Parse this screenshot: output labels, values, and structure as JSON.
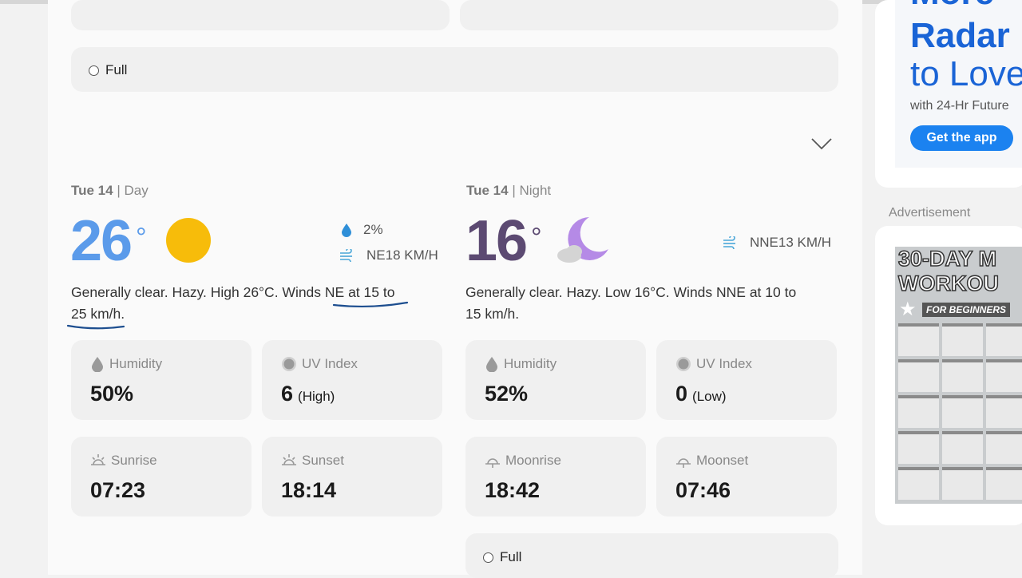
{
  "full_option_label": "Full",
  "day": {
    "date": "Tue 14",
    "period": "| Day",
    "temp": "26",
    "deg": "°",
    "precip": "2%",
    "wind": "NE18 KM/H",
    "description_a": "Generally clear. Hazy. High 26°C. Winds ",
    "description_b": "NE at 15 to",
    "description_c": "25 km/h",
    "description_d": ".",
    "humidity_label": "Humidity",
    "humidity": "50%",
    "uv_label": "UV Index",
    "uv_value": "6",
    "uv_level": "(High)",
    "sunrise_label": "Sunrise",
    "sunrise": "07:23",
    "sunset_label": "Sunset",
    "sunset": "18:14"
  },
  "night": {
    "date": "Tue 14",
    "period": "| Night",
    "temp": "16",
    "deg": "°",
    "wind": "NNE13 KM/H",
    "description": "Generally clear. Hazy. Low 16°C. Winds NNE at 10 to 15 km/h.",
    "humidity_label": "Humidity",
    "humidity": "52%",
    "uv_label": "UV Index",
    "uv_value": "0",
    "uv_level": "(Low)",
    "moonrise_label": "Moonrise",
    "moonrise": "18:42",
    "moonset_label": "Moonset",
    "moonset": "07:46"
  },
  "promo": {
    "line1": "More",
    "line2": "Radar",
    "line3": "to Love",
    "line4": "with 24-Hr Future",
    "button": "Get the app"
  },
  "ad": {
    "label": "Advertisement",
    "title1": "30-DAY M",
    "title2": "WORKOU",
    "subtitle": "FOR BEGINNERS"
  },
  "colors": {
    "day_temp": "#5b9bea",
    "night_temp": "#5c4a72",
    "sun": "#f7bc0a",
    "moon": "#b58ae6",
    "promo_blue": "#1a64d6",
    "button_blue": "#1b82f0",
    "underline": "#1d4e8f"
  }
}
